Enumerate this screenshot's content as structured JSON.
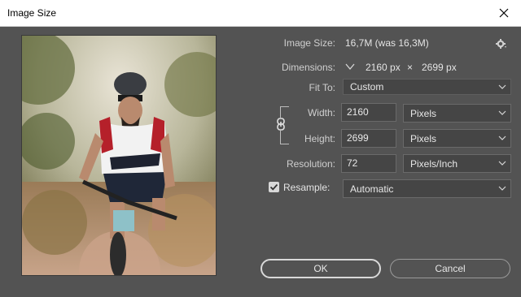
{
  "window": {
    "title": "Image Size"
  },
  "image_size": {
    "label": "Image Size:",
    "value": "16,7M (was 16,3M)"
  },
  "dimensions": {
    "label": "Dimensions:",
    "width": "2160 px",
    "separator": "×",
    "height": "2699 px"
  },
  "fit_to": {
    "label": "Fit To:",
    "value": "Custom"
  },
  "width": {
    "label": "Width:",
    "value": "2160",
    "unit": "Pixels"
  },
  "height": {
    "label": "Height:",
    "value": "2699",
    "unit": "Pixels"
  },
  "resolution": {
    "label": "Resolution:",
    "value": "72",
    "unit": "Pixels/Inch"
  },
  "resample": {
    "label": "Resample:",
    "checked": true,
    "value": "Automatic"
  },
  "buttons": {
    "ok": "OK",
    "cancel": "Cancel"
  },
  "icons": {
    "close": "close-icon",
    "settings": "gear-icon",
    "link": "chain-link-icon",
    "dropdown": "chevron-down-icon",
    "checkbox": "checkmark-icon"
  },
  "colors": {
    "dialog_bg": "#535353",
    "field_bg": "#454545",
    "titlebar_bg": "#ffffff"
  }
}
